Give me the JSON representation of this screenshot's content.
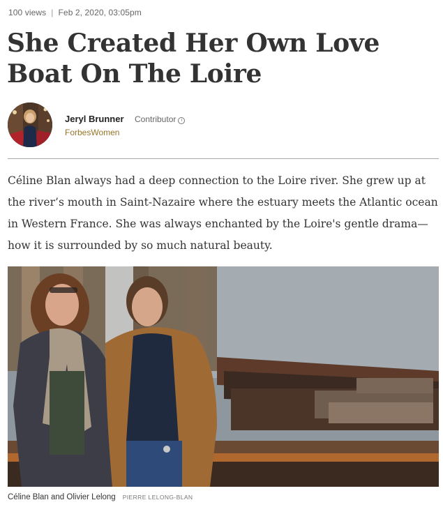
{
  "meta": {
    "views": "100 views",
    "separator": "|",
    "date": "Feb 2, 2020, 03:05pm"
  },
  "headline": "She Created Her Own Love Boat On The Loire",
  "author": {
    "name": "Jeryl Brunner",
    "role": "Contributor",
    "info_icon": "info-icon",
    "channel": "ForbesWomen"
  },
  "body": "Céline Blan always had a deep connection to the Loire river. She grew up at the river’s mouth in Saint-Nazaire where the estuary meets the Atlantic ocean in Western France. She was always enchanted by the Loire's gentle drama—how it is surrounded by so much natural beauty.",
  "image": {
    "caption": "Céline Blan and Olivier Lelong",
    "credit": "PIERRE LELONG-BLAN"
  },
  "colors": {
    "channel": "#96752a",
    "headline": "#333333",
    "divider": "#a9a9a9"
  }
}
